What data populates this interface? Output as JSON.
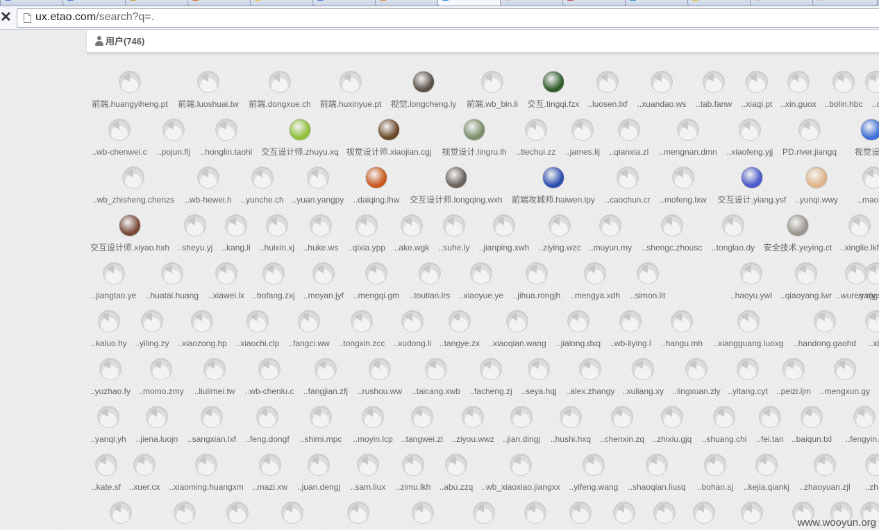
{
  "browser": {
    "tabs": [
      "",
      "",
      "",
      "",
      "",
      "",
      "",
      "",
      "",
      "",
      "",
      "",
      "",
      ""
    ],
    "tab_colors": [
      "#4d7bd3",
      "#4d7bd3",
      "#d6a033",
      "#e0662e",
      "#e6c72e",
      "#4d7bd3",
      "#e08a2e",
      "#3d8fd9",
      "#c7c7c7",
      "#b65050",
      "#2e8fc7",
      "#e6c72e",
      "#c7c7c7",
      "#c7c7c7"
    ],
    "stop_glyph": "✕",
    "url_host": "ux.etao.com",
    "url_rest": "/search?q=."
  },
  "header": {
    "users_label": "用户(746)"
  },
  "rows": [
    {
      "users": [
        {
          "name": "前端.huangyiheng.pt"
        },
        {
          "name": "前端.luoshuai.tw"
        },
        {
          "name": "前端.dongxue.ch"
        },
        {
          "name": "前端.huxinyue.pt"
        },
        {
          "name": "视觉.longcheng.ly",
          "photo": "#5b5248"
        },
        {
          "name": "前端.wb_bin.li"
        },
        {
          "name": "交互.tingqi.fzx",
          "photo": "#2f5d2a"
        },
        {
          "name": "..luosen.lxf"
        },
        {
          "name": "..xuandao.ws"
        },
        {
          "name": "..tab.fanw"
        },
        {
          "name": "..xiaqi.pt"
        },
        {
          "name": "..xin.guox"
        },
        {
          "name": "..bolin.hbc"
        },
        {
          "name": "..c"
        }
      ]
    },
    {
      "users": [
        {
          "name": "..wb-chenwei.c"
        },
        {
          "name": "..pojun.flj"
        },
        {
          "name": "..honglin.taohl"
        },
        {
          "name": "交互设计师.zhuyu.xq",
          "photo": "#8fbf3a"
        },
        {
          "name": "视觉设计师.xiaojian.cgj",
          "photo": "#6b4a2a"
        },
        {
          "name": "视觉设计.lingru.lh",
          "photo": "#7a8f6a"
        },
        {
          "name": "..tiechui.zz"
        },
        {
          "name": "..james.lij"
        },
        {
          "name": "..qianxia.zl"
        },
        {
          "name": "..mengnan.dmn"
        },
        {
          "name": "..xiaofeng.yjj"
        },
        {
          "name": "PD.river.jiangq"
        },
        {
          "name": "视觉设计",
          "photo": "#3c6fd8"
        }
      ]
    },
    {
      "users": [
        {
          "name": "..wb_zhisheng.chenzs"
        },
        {
          "name": "..wb-hewei.h"
        },
        {
          "name": "..yunche.ch"
        },
        {
          "name": "..yuan.yangpy"
        },
        {
          "name": "..daiqing.lhw",
          "photo": "#c85a1e"
        },
        {
          "name": "交互设计师.longqing.wxh",
          "photo": "#6a625c"
        },
        {
          "name": "前端攻城师.haiwen.lpy",
          "photo": "#2f4fb0"
        },
        {
          "name": "..caochun.cr"
        },
        {
          "name": "..mofeng.lxw"
        },
        {
          "name": "交互设计.yiang.ysf",
          "photo": "#4a5ac8"
        },
        {
          "name": "..yunqi.wwy",
          "photo": "#e0b48a"
        },
        {
          "name": "..maoxin"
        }
      ]
    },
    {
      "users": [
        {
          "name": "交互设计师.xiyao.hxh",
          "photo": "#7a4a3a"
        },
        {
          "name": "..sheyu.yj"
        },
        {
          "name": "..kang.li"
        },
        {
          "name": "..huixin.xj"
        },
        {
          "name": "..huke.ws"
        },
        {
          "name": "..qixia.ypp"
        },
        {
          "name": "..ake.wgk"
        },
        {
          "name": "..suhe.ly"
        },
        {
          "name": "..jianping.xwh"
        },
        {
          "name": "..ziying.wzc"
        },
        {
          "name": "..muyun.my"
        },
        {
          "name": "..shengc.zhousc"
        },
        {
          "name": "..tonglao.dy"
        },
        {
          "name": "安全技术.yeying.ct",
          "photo": "#9a958e"
        },
        {
          "name": "..xinglie.lkf"
        }
      ]
    },
    {
      "users": [
        {
          "name": "..jiangtao.ye"
        },
        {
          "name": "..huatai.huang"
        },
        {
          "name": "..xiawei.lx"
        },
        {
          "name": "..bofang.zxj"
        },
        {
          "name": "..moyan.jyf"
        },
        {
          "name": "..mengqi.gm"
        },
        {
          "name": "..toutian.lrs"
        },
        {
          "name": "..xiaoyue.ye"
        },
        {
          "name": "..jihua.rongjh"
        },
        {
          "name": "..mengya.xdh"
        },
        {
          "name": "..simon.lit"
        },
        {
          "name": "..haoyu.ywl"
        },
        {
          "name": "..qiaoyang.lwr"
        },
        {
          "name": "..wuren.cjy"
        },
        {
          "name": "..yangshi.lh"
        }
      ]
    },
    {
      "users": [
        {
          "name": "..kaluo.hy"
        },
        {
          "name": "..yiling.zy"
        },
        {
          "name": "..xiaozong.hp"
        },
        {
          "name": "..xiaochi.clp"
        },
        {
          "name": "..fangci.ww"
        },
        {
          "name": "..tongxin.zcc"
        },
        {
          "name": "..xudong.li"
        },
        {
          "name": "..tangye.zx"
        },
        {
          "name": "..xiaoqian.wang"
        },
        {
          "name": "..jialong.dxq"
        },
        {
          "name": "..wb-liying.l"
        },
        {
          "name": "..hangu.mh"
        },
        {
          "name": "..xiangguang.luoxg"
        },
        {
          "name": "..handong.gaohd"
        },
        {
          "name": "..xia"
        }
      ]
    },
    {
      "users": [
        {
          "name": "..yuzhao.fy"
        },
        {
          "name": "..momo.zmy"
        },
        {
          "name": "..liulimei.tw"
        },
        {
          "name": "..wb-chenlu.c"
        },
        {
          "name": "..fangjian.zfj"
        },
        {
          "name": "..rushou.ww"
        },
        {
          "name": "..taicang.xwb"
        },
        {
          "name": "..facheng.zj"
        },
        {
          "name": "..seya.hqj"
        },
        {
          "name": "..alex.zhangy"
        },
        {
          "name": "..xuliang.xy"
        },
        {
          "name": "..lingxuan.zly"
        },
        {
          "name": "..yitang.cyt"
        },
        {
          "name": "..peizi.ljm"
        },
        {
          "name": "..mengxun.gy"
        }
      ]
    },
    {
      "users": [
        {
          "name": "..yanqi.yh"
        },
        {
          "name": "..jiena.luojn"
        },
        {
          "name": "..sangxian.lxf"
        },
        {
          "name": "..feng.dongf"
        },
        {
          "name": "..shimi.mpc"
        },
        {
          "name": "..moyin.lcp"
        },
        {
          "name": "..tangwei.zl"
        },
        {
          "name": "..ziyou.wwz"
        },
        {
          "name": "..jian.dingj"
        },
        {
          "name": "..hushi.hxq"
        },
        {
          "name": "..chenxin.zq"
        },
        {
          "name": "..zhixiu.gjq"
        },
        {
          "name": "..shuang.chi"
        },
        {
          "name": "..fei.tan"
        },
        {
          "name": "..baiqun.txl"
        },
        {
          "name": "..fengyin.z"
        }
      ]
    },
    {
      "users": [
        {
          "name": "..kate.sf"
        },
        {
          "name": "..xuer.cx"
        },
        {
          "name": "..xiaoming.huangxm"
        },
        {
          "name": "..mazi.xw"
        },
        {
          "name": "..juan.dengj"
        },
        {
          "name": "..sam.liux"
        },
        {
          "name": "..zimu.lkh"
        },
        {
          "name": "..abu.zzq"
        },
        {
          "name": "..wb_xiaoxiao.jiangxx"
        },
        {
          "name": "..yifeng.wang"
        },
        {
          "name": "..shaoqian.liusq"
        },
        {
          "name": "..bohan.sj"
        },
        {
          "name": "..kejia.qiankj"
        },
        {
          "name": "..zhaoyuan.zjl"
        },
        {
          "name": "..zhan"
        }
      ]
    },
    {
      "users": [
        {
          "name": ""
        },
        {
          "name": ""
        },
        {
          "name": ""
        },
        {
          "name": ""
        },
        {
          "name": ""
        },
        {
          "name": ""
        },
        {
          "name": ""
        },
        {
          "name": ""
        },
        {
          "name": ""
        },
        {
          "name": ""
        },
        {
          "name": ""
        },
        {
          "name": ""
        },
        {
          "name": ""
        },
        {
          "name": ""
        },
        {
          "name": ""
        },
        {
          "name": ""
        }
      ]
    }
  ],
  "watermark": "www.wooyun.org"
}
